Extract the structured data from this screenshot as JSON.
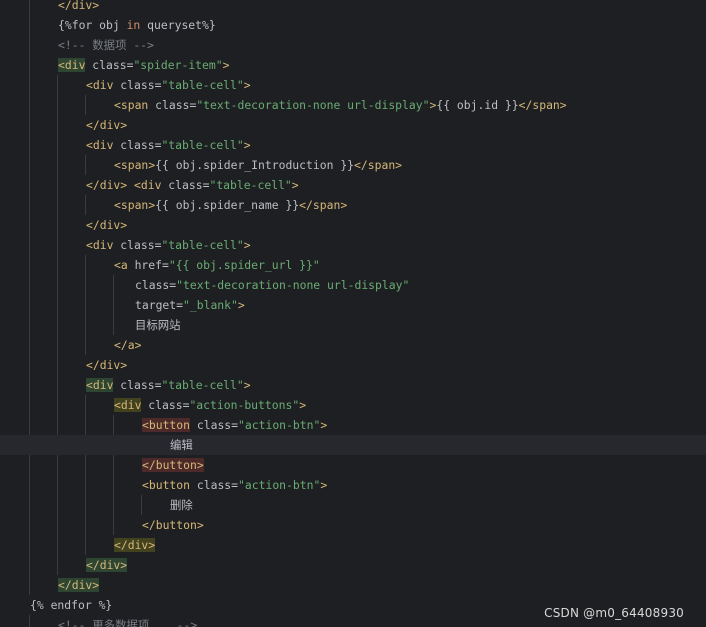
{
  "editor": {
    "lines": [
      {
        "indent": 4,
        "segs": [
          {
            "t": "</div>",
            "c": "tag"
          }
        ]
      },
      {
        "indent": 4,
        "segs": [
          {
            "t": "{%for obj ",
            "c": "plain"
          },
          {
            "t": "in",
            "c": "kw"
          },
          {
            "t": " queryset%}",
            "c": "plain"
          }
        ]
      },
      {
        "indent": 4,
        "segs": [
          {
            "t": "<!-- 数据项 -->",
            "c": "cmt"
          }
        ]
      },
      {
        "indent": 4,
        "segs": [
          {
            "t": "<div",
            "c": "tag",
            "hl": "green"
          },
          {
            "t": " class=",
            "c": "attr"
          },
          {
            "t": "\"spider-item\"",
            "c": "str"
          },
          {
            "t": ">",
            "c": "tag"
          }
        ]
      },
      {
        "indent": 6,
        "segs": [
          {
            "t": "<div",
            "c": "tag"
          },
          {
            "t": " class=",
            "c": "attr"
          },
          {
            "t": "\"table-cell\"",
            "c": "str"
          },
          {
            "t": ">",
            "c": "tag"
          }
        ]
      },
      {
        "indent": 8,
        "segs": [
          {
            "t": "<span",
            "c": "tag"
          },
          {
            "t": " class=",
            "c": "attr"
          },
          {
            "t": "\"text-decoration-none url-display\"",
            "c": "str"
          },
          {
            "t": ">",
            "c": "tag"
          },
          {
            "t": "{{ obj.id }}",
            "c": "plain"
          },
          {
            "t": "</span>",
            "c": "tag"
          }
        ]
      },
      {
        "indent": 6,
        "segs": [
          {
            "t": "</div>",
            "c": "tag"
          }
        ]
      },
      {
        "indent": 6,
        "segs": [
          {
            "t": "<div",
            "c": "tag"
          },
          {
            "t": " class=",
            "c": "attr"
          },
          {
            "t": "\"table-cell\"",
            "c": "str"
          },
          {
            "t": ">",
            "c": "tag"
          }
        ]
      },
      {
        "indent": 8,
        "segs": [
          {
            "t": "<span>",
            "c": "tag"
          },
          {
            "t": "{{ obj.spider_Introduction }}",
            "c": "plain"
          },
          {
            "t": "</span>",
            "c": "tag"
          }
        ]
      },
      {
        "indent": 6,
        "segs": [
          {
            "t": "</div>",
            "c": "tag"
          },
          {
            "t": " ",
            "c": "plain"
          },
          {
            "t": "<div",
            "c": "tag"
          },
          {
            "t": " class=",
            "c": "attr"
          },
          {
            "t": "\"table-cell\"",
            "c": "str"
          },
          {
            "t": ">",
            "c": "tag"
          }
        ]
      },
      {
        "indent": 8,
        "segs": [
          {
            "t": "<span>",
            "c": "tag"
          },
          {
            "t": "{{ obj.spider_name }}",
            "c": "plain"
          },
          {
            "t": "</span>",
            "c": "tag"
          }
        ]
      },
      {
        "indent": 6,
        "segs": [
          {
            "t": "</div>",
            "c": "tag"
          }
        ]
      },
      {
        "indent": 6,
        "segs": [
          {
            "t": "<div",
            "c": "tag"
          },
          {
            "t": " class=",
            "c": "attr"
          },
          {
            "t": "\"table-cell\"",
            "c": "str"
          },
          {
            "t": ">",
            "c": "tag"
          }
        ]
      },
      {
        "indent": 8,
        "segs": [
          {
            "t": "<a",
            "c": "tag"
          },
          {
            "t": " href=",
            "c": "attr"
          },
          {
            "t": "\"{{ obj.spider_url }}\"",
            "c": "str"
          }
        ]
      },
      {
        "indent": 9.5,
        "segs": [
          {
            "t": "class=",
            "c": "attr"
          },
          {
            "t": "\"text-decoration-none url-display\"",
            "c": "str"
          }
        ]
      },
      {
        "indent": 9.5,
        "segs": [
          {
            "t": "target=",
            "c": "attr"
          },
          {
            "t": "\"_blank\"",
            "c": "str"
          },
          {
            "t": ">",
            "c": "tag"
          }
        ]
      },
      {
        "indent": 9.5,
        "segs": [
          {
            "t": "目标网站",
            "c": "plain"
          }
        ]
      },
      {
        "indent": 8,
        "segs": [
          {
            "t": "</a>",
            "c": "tag"
          }
        ]
      },
      {
        "indent": 6,
        "segs": [
          {
            "t": "</div>",
            "c": "tag"
          }
        ]
      },
      {
        "indent": 6,
        "segs": [
          {
            "t": "<div",
            "c": "tag",
            "hl": "green"
          },
          {
            "t": " class=",
            "c": "attr"
          },
          {
            "t": "\"table-cell\"",
            "c": "str"
          },
          {
            "t": ">",
            "c": "tag"
          }
        ]
      },
      {
        "indent": 8,
        "segs": [
          {
            "t": "<div",
            "c": "tag",
            "hl": "olive"
          },
          {
            "t": " class=",
            "c": "attr"
          },
          {
            "t": "\"action-buttons\"",
            "c": "str"
          },
          {
            "t": ">",
            "c": "tag"
          }
        ]
      },
      {
        "indent": 10,
        "segs": [
          {
            "t": "<button",
            "c": "tag",
            "hl": "red"
          },
          {
            "t": " class=",
            "c": "attr"
          },
          {
            "t": "\"action-btn\"",
            "c": "str"
          },
          {
            "t": ">",
            "c": "tag"
          }
        ]
      },
      {
        "indent": 12,
        "current": true,
        "segs": [
          {
            "t": "编辑",
            "c": "plain"
          }
        ]
      },
      {
        "indent": 10,
        "segs": [
          {
            "t": "</button>",
            "c": "tag",
            "hl": "red"
          }
        ]
      },
      {
        "indent": 10,
        "segs": [
          {
            "t": "<button",
            "c": "tag"
          },
          {
            "t": " class=",
            "c": "attr"
          },
          {
            "t": "\"action-btn\"",
            "c": "str"
          },
          {
            "t": ">",
            "c": "tag"
          }
        ]
      },
      {
        "indent": 12,
        "segs": [
          {
            "t": "删除",
            "c": "plain"
          }
        ]
      },
      {
        "indent": 10,
        "segs": [
          {
            "t": "</button>",
            "c": "tag"
          }
        ]
      },
      {
        "indent": 8,
        "segs": [
          {
            "t": "</div>",
            "c": "tag",
            "hl": "olive"
          }
        ]
      },
      {
        "indent": 6,
        "segs": [
          {
            "t": "</div>",
            "c": "tag",
            "hl": "green"
          }
        ]
      },
      {
        "indent": 4,
        "segs": [
          {
            "t": "</div>",
            "c": "tag",
            "hl": "green"
          }
        ]
      },
      {
        "indent": 2,
        "segs": [
          {
            "t": "{% endfor %}",
            "c": "plain"
          }
        ]
      },
      {
        "indent": 4,
        "segs": [
          {
            "t": "<!-- 更多数据项... -->",
            "c": "cmt"
          }
        ]
      }
    ]
  },
  "colors": {
    "background": "#1e1f22",
    "tag": "#d5b778",
    "string": "#6aab73",
    "comment": "#7a7e85",
    "keyword": "#cf8e6d",
    "text": "#bcbec4",
    "current_line": "#26282e"
  },
  "watermark": "CSDN @m0_64408930"
}
